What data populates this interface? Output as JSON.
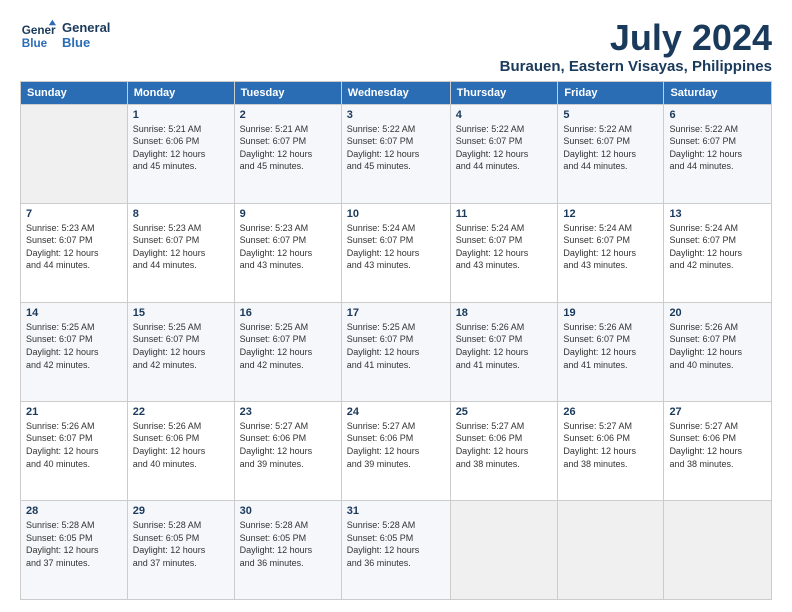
{
  "header": {
    "logo_line1": "General",
    "logo_line2": "Blue",
    "title": "July 2024",
    "subtitle": "Burauen, Eastern Visayas, Philippines"
  },
  "columns": [
    "Sunday",
    "Monday",
    "Tuesday",
    "Wednesday",
    "Thursday",
    "Friday",
    "Saturday"
  ],
  "weeks": [
    [
      {
        "day": "",
        "info": ""
      },
      {
        "day": "1",
        "info": "Sunrise: 5:21 AM\nSunset: 6:06 PM\nDaylight: 12 hours\nand 45 minutes."
      },
      {
        "day": "2",
        "info": "Sunrise: 5:21 AM\nSunset: 6:07 PM\nDaylight: 12 hours\nand 45 minutes."
      },
      {
        "day": "3",
        "info": "Sunrise: 5:22 AM\nSunset: 6:07 PM\nDaylight: 12 hours\nand 45 minutes."
      },
      {
        "day": "4",
        "info": "Sunrise: 5:22 AM\nSunset: 6:07 PM\nDaylight: 12 hours\nand 44 minutes."
      },
      {
        "day": "5",
        "info": "Sunrise: 5:22 AM\nSunset: 6:07 PM\nDaylight: 12 hours\nand 44 minutes."
      },
      {
        "day": "6",
        "info": "Sunrise: 5:22 AM\nSunset: 6:07 PM\nDaylight: 12 hours\nand 44 minutes."
      }
    ],
    [
      {
        "day": "7",
        "info": "Sunrise: 5:23 AM\nSunset: 6:07 PM\nDaylight: 12 hours\nand 44 minutes."
      },
      {
        "day": "8",
        "info": "Sunrise: 5:23 AM\nSunset: 6:07 PM\nDaylight: 12 hours\nand 44 minutes."
      },
      {
        "day": "9",
        "info": "Sunrise: 5:23 AM\nSunset: 6:07 PM\nDaylight: 12 hours\nand 43 minutes."
      },
      {
        "day": "10",
        "info": "Sunrise: 5:24 AM\nSunset: 6:07 PM\nDaylight: 12 hours\nand 43 minutes."
      },
      {
        "day": "11",
        "info": "Sunrise: 5:24 AM\nSunset: 6:07 PM\nDaylight: 12 hours\nand 43 minutes."
      },
      {
        "day": "12",
        "info": "Sunrise: 5:24 AM\nSunset: 6:07 PM\nDaylight: 12 hours\nand 43 minutes."
      },
      {
        "day": "13",
        "info": "Sunrise: 5:24 AM\nSunset: 6:07 PM\nDaylight: 12 hours\nand 42 minutes."
      }
    ],
    [
      {
        "day": "14",
        "info": "Sunrise: 5:25 AM\nSunset: 6:07 PM\nDaylight: 12 hours\nand 42 minutes."
      },
      {
        "day": "15",
        "info": "Sunrise: 5:25 AM\nSunset: 6:07 PM\nDaylight: 12 hours\nand 42 minutes."
      },
      {
        "day": "16",
        "info": "Sunrise: 5:25 AM\nSunset: 6:07 PM\nDaylight: 12 hours\nand 42 minutes."
      },
      {
        "day": "17",
        "info": "Sunrise: 5:25 AM\nSunset: 6:07 PM\nDaylight: 12 hours\nand 41 minutes."
      },
      {
        "day": "18",
        "info": "Sunrise: 5:26 AM\nSunset: 6:07 PM\nDaylight: 12 hours\nand 41 minutes."
      },
      {
        "day": "19",
        "info": "Sunrise: 5:26 AM\nSunset: 6:07 PM\nDaylight: 12 hours\nand 41 minutes."
      },
      {
        "day": "20",
        "info": "Sunrise: 5:26 AM\nSunset: 6:07 PM\nDaylight: 12 hours\nand 40 minutes."
      }
    ],
    [
      {
        "day": "21",
        "info": "Sunrise: 5:26 AM\nSunset: 6:07 PM\nDaylight: 12 hours\nand 40 minutes."
      },
      {
        "day": "22",
        "info": "Sunrise: 5:26 AM\nSunset: 6:06 PM\nDaylight: 12 hours\nand 40 minutes."
      },
      {
        "day": "23",
        "info": "Sunrise: 5:27 AM\nSunset: 6:06 PM\nDaylight: 12 hours\nand 39 minutes."
      },
      {
        "day": "24",
        "info": "Sunrise: 5:27 AM\nSunset: 6:06 PM\nDaylight: 12 hours\nand 39 minutes."
      },
      {
        "day": "25",
        "info": "Sunrise: 5:27 AM\nSunset: 6:06 PM\nDaylight: 12 hours\nand 38 minutes."
      },
      {
        "day": "26",
        "info": "Sunrise: 5:27 AM\nSunset: 6:06 PM\nDaylight: 12 hours\nand 38 minutes."
      },
      {
        "day": "27",
        "info": "Sunrise: 5:27 AM\nSunset: 6:06 PM\nDaylight: 12 hours\nand 38 minutes."
      }
    ],
    [
      {
        "day": "28",
        "info": "Sunrise: 5:28 AM\nSunset: 6:05 PM\nDaylight: 12 hours\nand 37 minutes."
      },
      {
        "day": "29",
        "info": "Sunrise: 5:28 AM\nSunset: 6:05 PM\nDaylight: 12 hours\nand 37 minutes."
      },
      {
        "day": "30",
        "info": "Sunrise: 5:28 AM\nSunset: 6:05 PM\nDaylight: 12 hours\nand 36 minutes."
      },
      {
        "day": "31",
        "info": "Sunrise: 5:28 AM\nSunset: 6:05 PM\nDaylight: 12 hours\nand 36 minutes."
      },
      {
        "day": "",
        "info": ""
      },
      {
        "day": "",
        "info": ""
      },
      {
        "day": "",
        "info": ""
      }
    ]
  ]
}
